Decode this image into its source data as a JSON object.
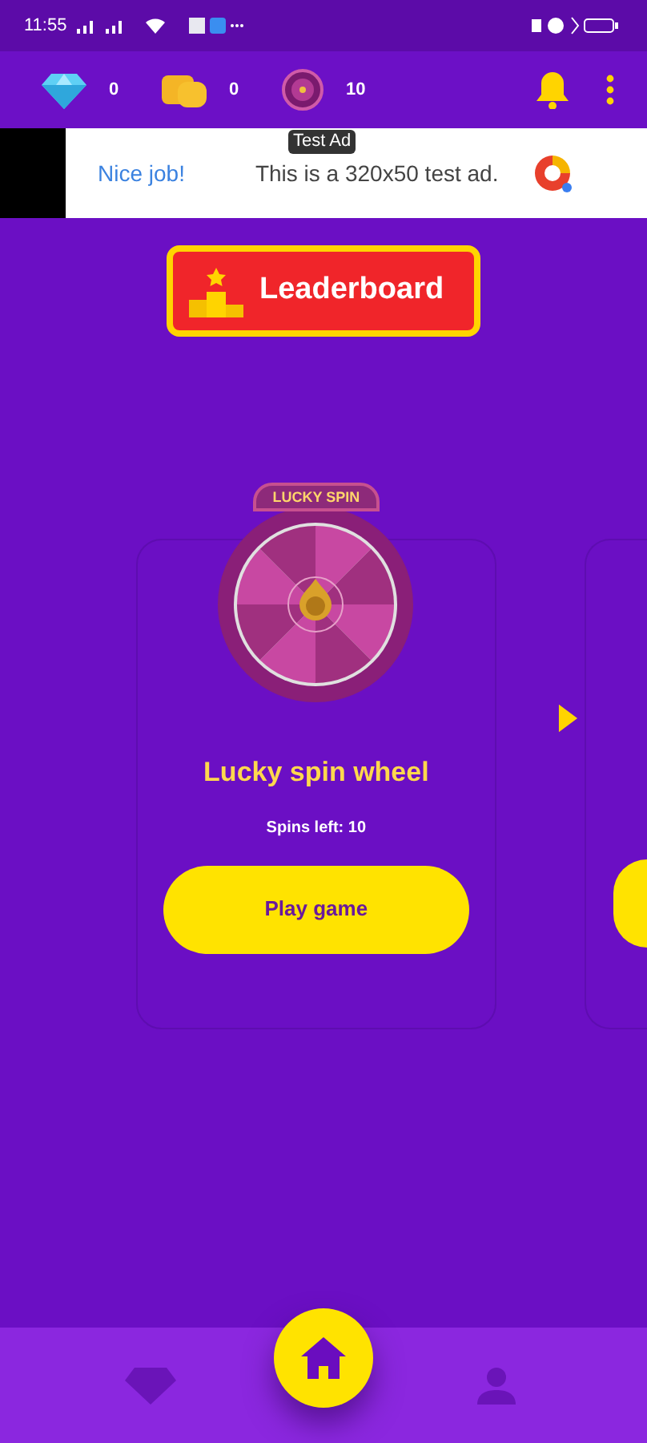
{
  "status_bar": {
    "time": "11:55"
  },
  "counters": [
    {
      "kind": "diamond",
      "value": "0"
    },
    {
      "kind": "coins",
      "value": "0"
    },
    {
      "kind": "wheel",
      "value": "10"
    }
  ],
  "tooltip": "Test Ad",
  "ad": {
    "headline": "Nice job!",
    "text": "This is a 320x50 test ad."
  },
  "leaderboard": {
    "label": "Leaderboard"
  },
  "game_card": {
    "badge": "LUCKY SPIN",
    "title": "Lucky spin wheel",
    "subtitle": "Spins left: 10",
    "button": "Play game"
  },
  "bottom_nav": [
    {
      "kind": "diamond",
      "selected": false
    },
    {
      "kind": "home",
      "selected": true
    },
    {
      "kind": "profile",
      "selected": false
    }
  ]
}
